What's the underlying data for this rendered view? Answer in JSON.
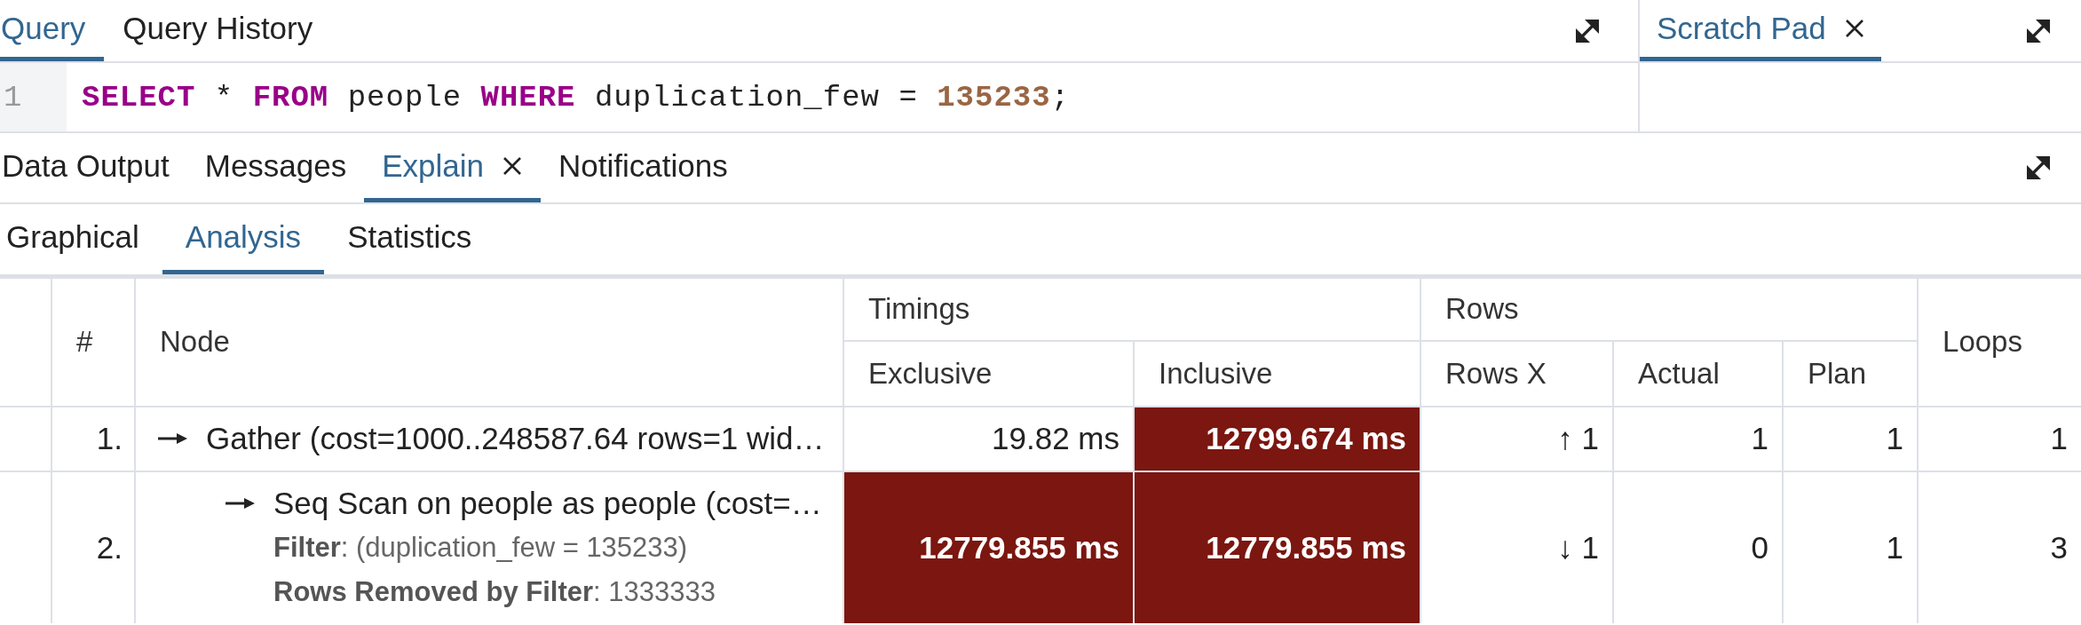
{
  "query_panel": {
    "tabs": [
      {
        "label": "Query",
        "selected": true
      },
      {
        "label": "Query History",
        "selected": false
      }
    ],
    "editor": {
      "lines": [
        {
          "number": "1",
          "tokens": [
            {
              "kind": "keyword",
              "text": "SELECT"
            },
            {
              "kind": "plain",
              "text": " * "
            },
            {
              "kind": "keyword",
              "text": "FROM"
            },
            {
              "kind": "plain",
              "text": " people "
            },
            {
              "kind": "keyword",
              "text": "WHERE"
            },
            {
              "kind": "plain",
              "text": " duplication_few = "
            },
            {
              "kind": "number",
              "text": "135233"
            },
            {
              "kind": "plain",
              "text": ";"
            }
          ]
        }
      ]
    }
  },
  "scratch_pad": {
    "tabs": [
      {
        "label": "Scratch Pad",
        "selected": true,
        "closable": true
      }
    ]
  },
  "output_panel": {
    "tabs": [
      {
        "label": "Data Output",
        "selected": false,
        "closable": false
      },
      {
        "label": "Messages",
        "selected": false,
        "closable": false
      },
      {
        "label": "Explain",
        "selected": true,
        "closable": true
      },
      {
        "label": "Notifications",
        "selected": false,
        "closable": false
      }
    ],
    "explain_tabs": [
      {
        "label": "Graphical",
        "selected": false
      },
      {
        "label": "Analysis",
        "selected": true
      },
      {
        "label": "Statistics",
        "selected": false
      }
    ],
    "table": {
      "header_groups": [
        {
          "label": "#"
        },
        {
          "label": "Node"
        },
        {
          "label": "Timings",
          "columns": [
            "Exclusive",
            "Inclusive"
          ]
        },
        {
          "label": "Rows",
          "columns": [
            "Rows X",
            "Actual",
            "Plan"
          ]
        },
        {
          "label": "Loops"
        }
      ],
      "rows": [
        {
          "number": "1.",
          "node": "Gather (cost=1000..248587.64 rows=1 wid…",
          "exclusive": {
            "text": "19.82 ms",
            "highlighted": false
          },
          "inclusive": {
            "text": "12799.674 ms",
            "highlighted": true
          },
          "rows_x": "↑ 1",
          "actual": "1",
          "plan": "1",
          "loops": "1",
          "children": [
            {
              "number": "2.",
              "node": "Seq Scan on people as people (cost=…",
              "details": [
                "**Filter**: (duplication_few = 135233)",
                "**Rows Removed by Filter**: 1333333"
              ],
              "exclusive": {
                "text": "12779.855 ms",
                "highlighted": true
              },
              "inclusive": {
                "text": "12779.855 ms",
                "highlighted": true
              },
              "rows_x": "↓ 1",
              "actual": "0",
              "plan": "1",
              "loops": "3"
            }
          ]
        }
      ]
    }
  }
}
